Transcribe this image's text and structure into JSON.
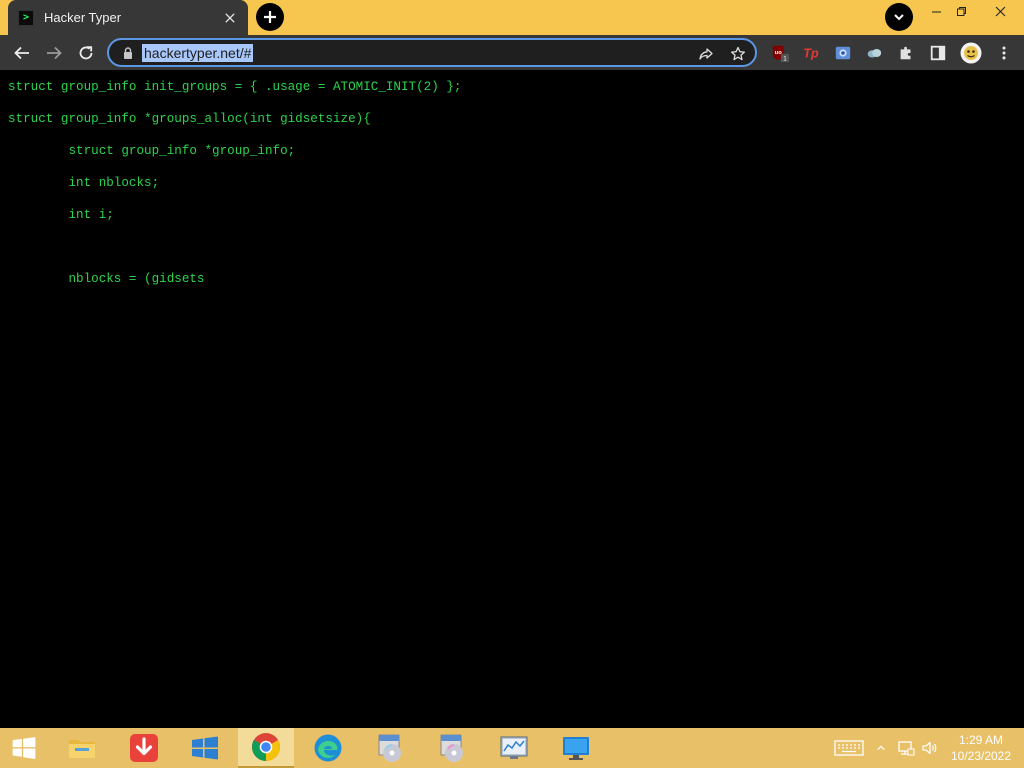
{
  "browser": {
    "tab": {
      "favicon_glyph": ">",
      "title": "Hacker Typer"
    },
    "address_bar": {
      "url": "hackertyper.net/#"
    },
    "accent_color": "#f6c64f",
    "extensions": [
      "ublock-origin-icon",
      "tp-icon",
      "photo-icon",
      "cloud-icon",
      "puzzle-icon",
      "sidepanel-icon",
      "profile-avatar"
    ],
    "extension_badges": {
      "ublock": "1",
      "tp": "Tp",
      "ublock_label": "uo"
    }
  },
  "page": {
    "background": "#000000",
    "code_color": "#2bd44c",
    "code_lines": [
      "struct group_info init_groups = { .usage = ATOMIC_INIT(2) };",
      "struct group_info *groups_alloc(int gidsetsize){",
      "        struct group_info *group_info;",
      "        int nblocks;",
      "        int i;",
      "",
      "        nblocks = (gidsets"
    ]
  },
  "taskbar": {
    "apps": [
      "start-button",
      "file-explorer",
      "download-manager",
      "windows-app",
      "chrome",
      "edge",
      "cd-installer-1",
      "cd-installer-2",
      "resource-monitor",
      "remote-desktop"
    ],
    "active_app": "chrome",
    "clock": {
      "time": "1:29 AM",
      "date": "10/23/2022"
    }
  }
}
